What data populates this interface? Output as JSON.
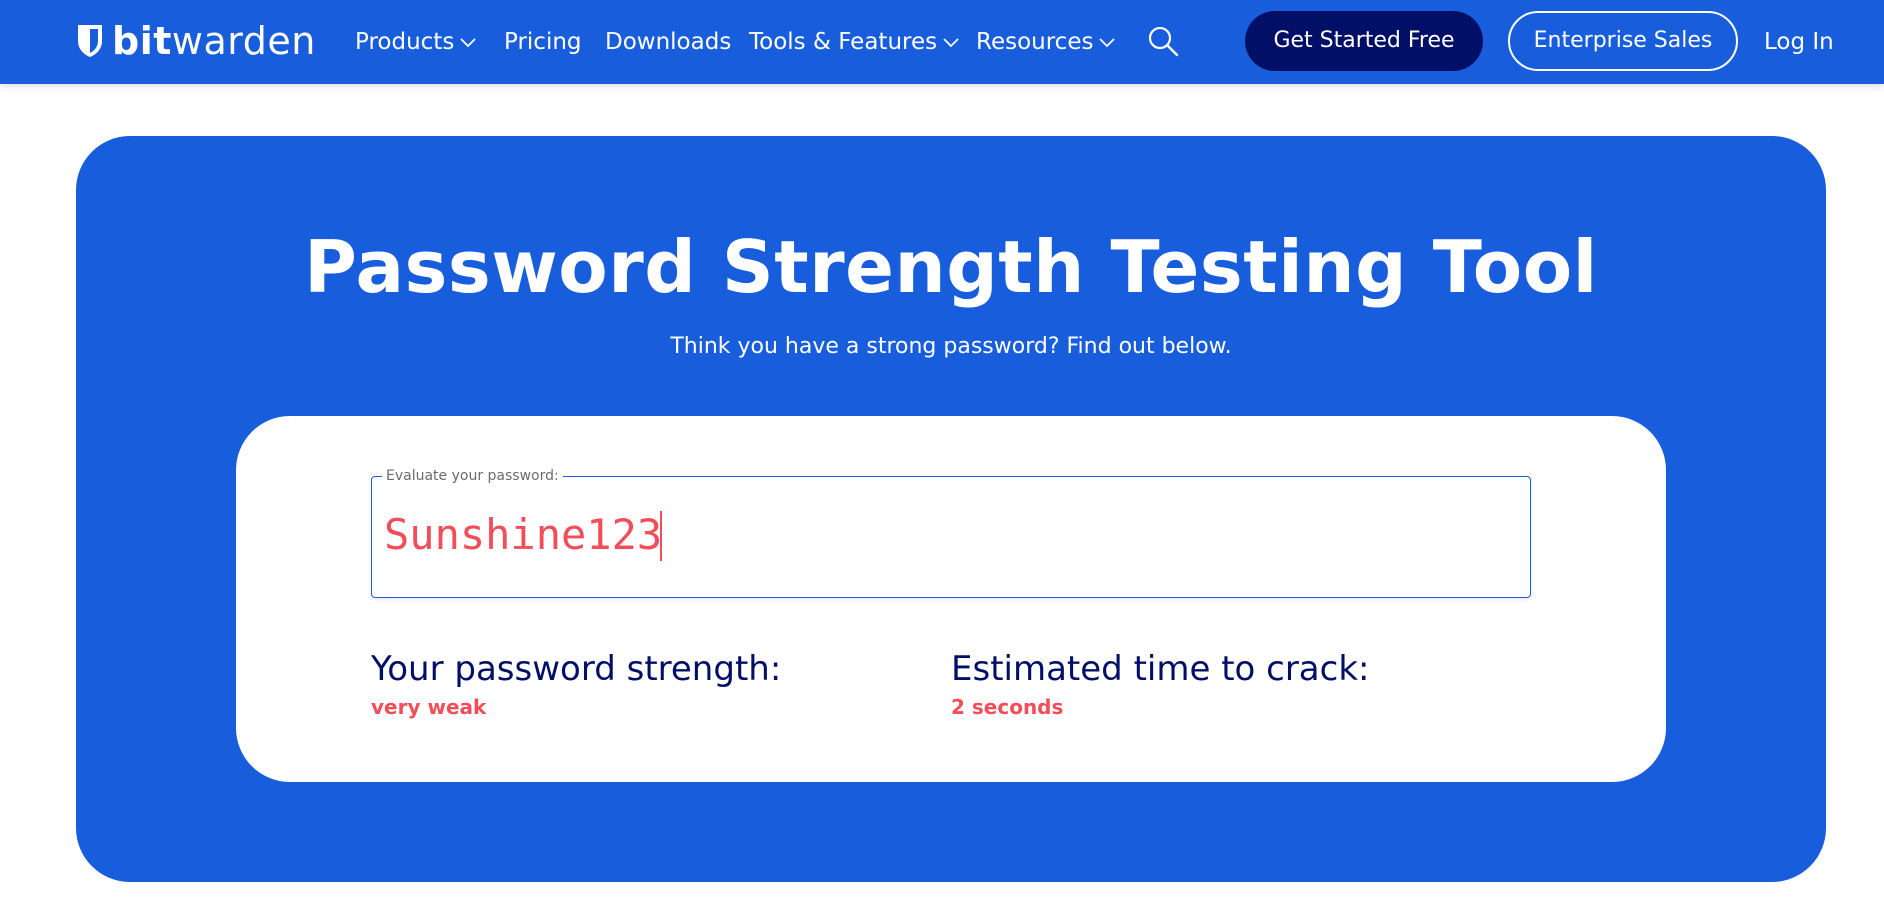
{
  "header": {
    "logo": {
      "bold": "bit",
      "regular": "warden",
      "icon": "shield-icon"
    },
    "nav": [
      {
        "label": "Products",
        "has_dropdown": true
      },
      {
        "label": "Pricing",
        "has_dropdown": false
      },
      {
        "label": "Downloads",
        "has_dropdown": false
      },
      {
        "label": "Tools & Features",
        "has_dropdown": true
      },
      {
        "label": "Resources",
        "has_dropdown": true
      }
    ],
    "search_icon": "search-icon",
    "cta_primary": "Get Started Free",
    "cta_secondary": "Enterprise Sales",
    "login": "Log In"
  },
  "hero": {
    "title": "Password Strength Testing Tool",
    "subtitle": "Think you have a strong password? Find out below."
  },
  "checker": {
    "field_label": "Evaluate your password:",
    "password_value": "Sunshine123",
    "strength_heading": "Your password strength:",
    "strength_value": "very weak",
    "crack_heading": "Estimated time to crack:",
    "crack_value": "2 seconds"
  },
  "colors": {
    "brand_blue": "#175ddc",
    "navy": "#020f66",
    "weak_red": "#f24e5a",
    "white": "#ffffff"
  }
}
